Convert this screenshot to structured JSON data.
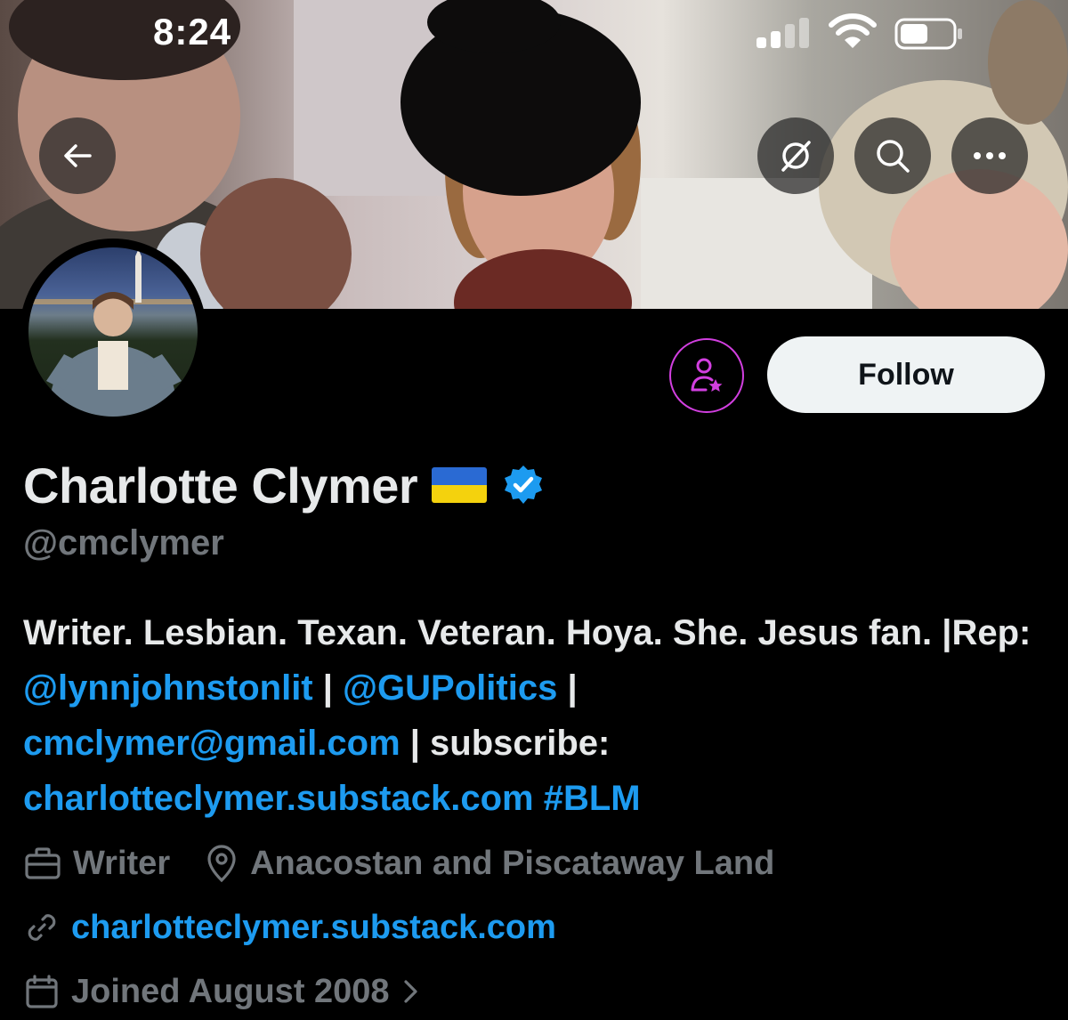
{
  "status_bar": {
    "time": "8:24"
  },
  "header": {
    "back_icon": "arrow-left-icon",
    "grok_icon": "grok-icon",
    "search_icon": "search-icon",
    "more_icon": "more-horizontal-icon"
  },
  "actions": {
    "subscribe_icon": "person-star-icon",
    "follow_label": "Follow",
    "subscribe_color": "#d23fe0"
  },
  "profile": {
    "name": "Charlotte Clymer",
    "flag": "ukraine-flag",
    "verified_color": "#1d9bf0",
    "handle": "@cmclymer",
    "bio": {
      "part1": "Writer. Lesbian. Texan. Veteran. Hoya. She. Jesus fan. |Rep: ",
      "mention1": "@lynnjohnstonlit",
      "sep1": " | ",
      "mention2": "@GUPolitics",
      "sep2": " | ",
      "email": "cmclymer@gmail.com",
      "part2": " | subscribe: ",
      "url": "charlotteclymer.substack.com",
      "space": " ",
      "hashtag": "#BLM"
    },
    "profession": "Writer",
    "location": "Anacostan and Piscataway Land",
    "website": "charlotteclymer.substack.com",
    "joined": "Joined August 2008"
  },
  "colors": {
    "background": "#000000",
    "text": "#e7e9ea",
    "muted": "#71767b",
    "link": "#1d9bf0",
    "follow_bg": "#eff3f4"
  }
}
